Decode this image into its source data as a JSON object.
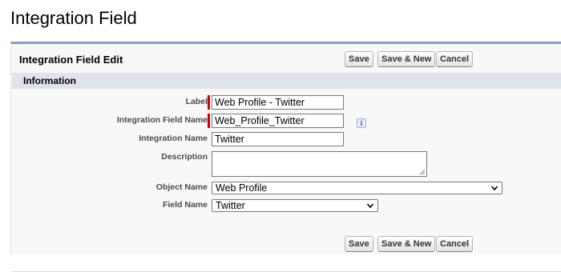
{
  "page": {
    "title": "Integration Field"
  },
  "panel": {
    "title": "Integration Field Edit",
    "buttons": {
      "save": "Save",
      "save_new": "Save & New",
      "cancel": "Cancel"
    }
  },
  "section": {
    "title": "Information"
  },
  "fields": {
    "label": {
      "label": "Label",
      "value": "Web Profile - Twitter",
      "required": true
    },
    "integration_field_name": {
      "label": "Integration Field Name",
      "value": "Web_Profile_Twitter",
      "required": true,
      "info_icon": "i"
    },
    "integration_name": {
      "label": "Integration Name",
      "value": "Twitter"
    },
    "description": {
      "label": "Description",
      "value": ""
    },
    "object_name": {
      "label": "Object Name",
      "value": "Web Profile"
    },
    "field_name": {
      "label": "Field Name",
      "value": "Twitter"
    }
  },
  "colors": {
    "required": "#cc0000",
    "panel_border": "#8a9ebe",
    "section_bar": "#dfe3ea"
  }
}
